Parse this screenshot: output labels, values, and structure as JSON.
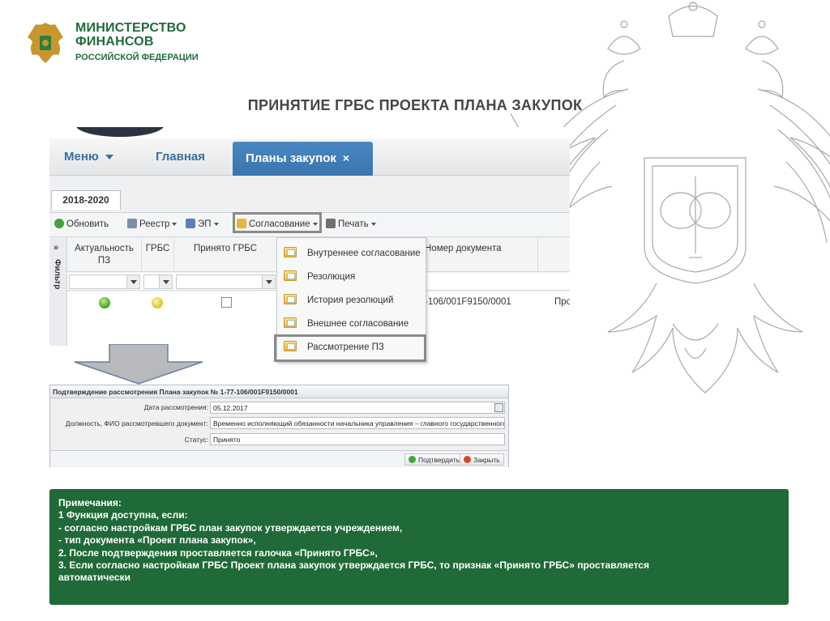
{
  "header": {
    "ministry_line1": "МИНИСТЕРСТВО",
    "ministry_line2": "ФИНАНСОВ",
    "ministry_line3": "РОССИЙСКОЙ ФЕДЕРАЦИИ"
  },
  "slide_title": "ПРИНЯТИЕ ГРБС ПРОЕКТА ПЛАНА ЗАКУПОК",
  "app": {
    "nav": {
      "menu_label": "Меню",
      "home_label": "Главная",
      "active_tab_label": "Планы закупок",
      "tab_close": "×"
    },
    "year_tab": "2018-2020",
    "toolbar": {
      "refresh": "Обновить",
      "registry": "Реестр",
      "ep": "ЭП",
      "approval": "Согласование",
      "print": "Печать"
    },
    "side_filter": "Фильтр",
    "side_collapse": "»",
    "columns": {
      "relevance": "Актуальность ПЗ",
      "grbs": "ГРБС",
      "accepted_grbs": "Принято ГРБС",
      "doc_number": "Номер документа"
    },
    "row": {
      "doc_number": "-106/001F9150/0001",
      "extra": "Про",
      "relevance_status": "green",
      "grbs_status": "yellow"
    },
    "dropdown": {
      "items": [
        "Внутреннее согласование",
        "Резолюция",
        "История резолюций",
        "Внешнее согласование",
        "Рассмотрение ПЗ"
      ]
    }
  },
  "dialog": {
    "title": "Подтверждение рассмотрения Плана закупок № 1-77-106/001F9150/0001",
    "date_label": "Дата рассмотрения:",
    "date_value": "05.12.2017",
    "position_label": "Должность, ФИО рассмотревшего документ:",
    "position_value": "Временно исполняющий обязанности начальника управления – главного государственного",
    "status_label": "Статус:",
    "status_value": "Принято",
    "confirm_button": "Подтвердить",
    "close_button": "Закрыть"
  },
  "notes": {
    "lines": [
      "Примечания:",
      "1 Функция доступна, если:",
      "-    согласно настройкам ГРБС план закупок утверждается учреждением,",
      "-    тип  документа «Проект плана закупок»,",
      "2. После подтверждения проставляется галочка «Принято ГРБС»,",
      "3. Если согласно настройкам ГРБС Проект плана закупок утверждается ГРБС, то признак «Принято ГРБС» проставляется",
      "автоматически"
    ]
  },
  "colors": {
    "brand_green": "#1f6a38",
    "nav_blue": "#3a6ea5",
    "active_tab": "#3f7db8"
  }
}
